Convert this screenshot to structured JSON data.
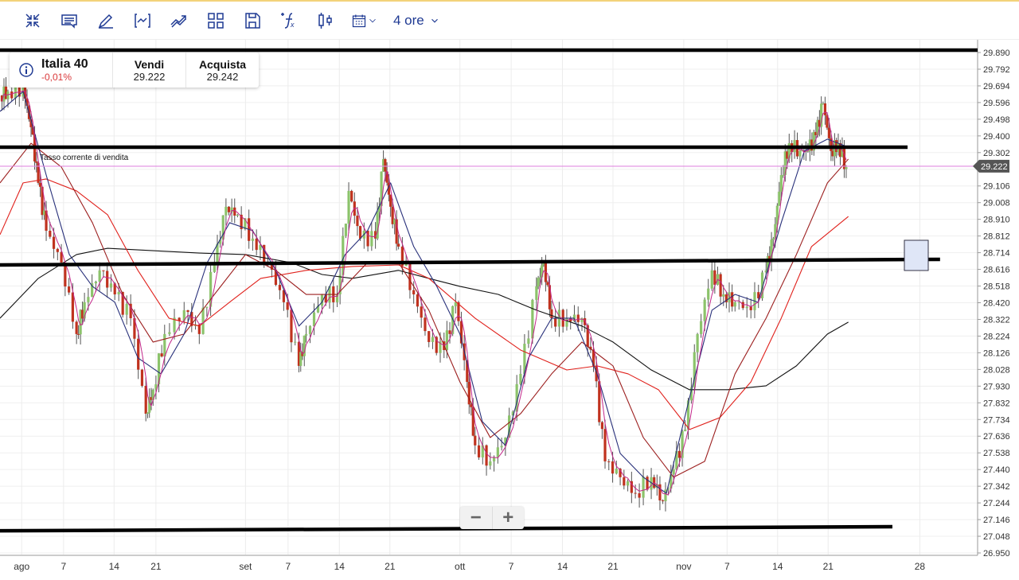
{
  "toolbar": {
    "icons": [
      "collapse-icon",
      "comment-icon",
      "pencil-icon",
      "indicator-bracket-icon",
      "trend-icon",
      "grid-layout-icon",
      "save-icon",
      "function-icon",
      "candlestick-icon",
      "calendar-icon"
    ],
    "timeframe": "4 ore"
  },
  "instrument": {
    "name": "Italia 40",
    "change": "-0,01%",
    "sell_label": "Vendi",
    "sell_value": "29.222",
    "buy_label": "Acquista",
    "buy_value": "29.242"
  },
  "zoom": {
    "minus": "−",
    "plus": "+"
  },
  "colors": {
    "up": "#8cc36b",
    "down": "#c0321e",
    "ma200": "#111111",
    "ma100": "#e0201b",
    "ma50": "#9c1f1f",
    "ma20": "#28307a",
    "ma10": "#c2278a",
    "current": "#e08be0",
    "accent": "#1f3a93"
  },
  "chart_data": {
    "type": "candlestick",
    "current_price_label": "Tasso corrente di vendita",
    "current_price": 29.222,
    "current_price_text": "29.222",
    "ylim": [
      26.95,
      29.89
    ],
    "y_ticks": [
      "29.890",
      "29.792",
      "29.694",
      "29.596",
      "29.498",
      "29.400",
      "29.302",
      "29.106",
      "29.008",
      "28.910",
      "28.812",
      "28.714",
      "28.616",
      "28.518",
      "28.420",
      "28.322",
      "28.224",
      "28.126",
      "28.028",
      "27.930",
      "27.832",
      "27.734",
      "27.636",
      "27.538",
      "27.440",
      "27.342",
      "27.244",
      "27.146",
      "27.048",
      "26.950"
    ],
    "x_ticks": [
      {
        "t": 0,
        "label": "ago"
      },
      {
        "t": 5.8,
        "label": "7"
      },
      {
        "t": 12.8,
        "label": "14"
      },
      {
        "t": 18.6,
        "label": "21"
      },
      {
        "t": 31,
        "label": "set"
      },
      {
        "t": 36.9,
        "label": "7"
      },
      {
        "t": 44,
        "label": "14"
      },
      {
        "t": 51,
        "label": "21"
      },
      {
        "t": 60.7,
        "label": "ott"
      },
      {
        "t": 67.8,
        "label": "7"
      },
      {
        "t": 74.9,
        "label": "14"
      },
      {
        "t": 81.9,
        "label": "21"
      },
      {
        "t": 91.7,
        "label": "nov"
      },
      {
        "t": 97.7,
        "label": "7"
      },
      {
        "t": 104.7,
        "label": "14"
      },
      {
        "t": 111.7,
        "label": "21"
      },
      {
        "t": 124.4,
        "label": "28"
      }
    ],
    "xlim": [
      -3,
      132.4
    ],
    "closes": [
      [
        -3.0,
        29.638
      ],
      [
        -1.9,
        29.661
      ],
      [
        0.2,
        29.684
      ],
      [
        1.3,
        29.451
      ],
      [
        2.3,
        29.124
      ],
      [
        3.4,
        28.843
      ],
      [
        5.5,
        28.656
      ],
      [
        7.6,
        28.236
      ],
      [
        8.7,
        28.423
      ],
      [
        10.8,
        28.61
      ],
      [
        12.9,
        28.469
      ],
      [
        15.1,
        28.329
      ],
      [
        17.2,
        27.768
      ],
      [
        18.2,
        27.909
      ],
      [
        19.8,
        28.236
      ],
      [
        22.5,
        28.376
      ],
      [
        24.6,
        28.236
      ],
      [
        26.7,
        28.656
      ],
      [
        28.3,
        28.984
      ],
      [
        29.9,
        28.937
      ],
      [
        32.0,
        28.797
      ],
      [
        34.1,
        28.656
      ],
      [
        36.3,
        28.423
      ],
      [
        38.4,
        28.049
      ],
      [
        39.4,
        28.236
      ],
      [
        41.6,
        28.469
      ],
      [
        43.7,
        28.469
      ],
      [
        45.3,
        29.077
      ],
      [
        46.9,
        28.797
      ],
      [
        49.0,
        28.797
      ],
      [
        50.1,
        29.264
      ],
      [
        51.1,
        28.984
      ],
      [
        52.2,
        28.75
      ],
      [
        54.3,
        28.469
      ],
      [
        56.4,
        28.189
      ],
      [
        58.5,
        28.142
      ],
      [
        60.1,
        28.423
      ],
      [
        61.7,
        27.955
      ],
      [
        62.8,
        27.582
      ],
      [
        64.9,
        27.488
      ],
      [
        67.0,
        27.628
      ],
      [
        69.1,
        28.002
      ],
      [
        71.3,
        28.516
      ],
      [
        72.3,
        28.656
      ],
      [
        73.4,
        28.329
      ],
      [
        75.5,
        28.329
      ],
      [
        77.6,
        28.329
      ],
      [
        79.2,
        28.049
      ],
      [
        80.8,
        27.488
      ],
      [
        82.9,
        27.395
      ],
      [
        85.0,
        27.301
      ],
      [
        87.2,
        27.395
      ],
      [
        88.8,
        27.254
      ],
      [
        90.3,
        27.441
      ],
      [
        91.9,
        27.675
      ],
      [
        93.6,
        28.236
      ],
      [
        95.6,
        28.61
      ],
      [
        97.2,
        28.469
      ],
      [
        98.8,
        28.423
      ],
      [
        101.0,
        28.376
      ],
      [
        103.1,
        28.61
      ],
      [
        104.1,
        28.797
      ],
      [
        105.2,
        29.17
      ],
      [
        106.3,
        29.357
      ],
      [
        107.8,
        29.311
      ],
      [
        108.9,
        29.311
      ],
      [
        110.0,
        29.404
      ],
      [
        111.0,
        29.591
      ],
      [
        112.1,
        29.311
      ],
      [
        113.1,
        29.357
      ],
      [
        114.2,
        29.217
      ]
    ],
    "moving_averages": [
      {
        "name": "ma200",
        "points": [
          [
            -3.0,
            28.329
          ],
          [
            2.3,
            28.563
          ],
          [
            7.6,
            28.703
          ],
          [
            11.9,
            28.74
          ],
          [
            18.2,
            28.726
          ],
          [
            24.6,
            28.712
          ],
          [
            31.0,
            28.703
          ],
          [
            37.3,
            28.656
          ],
          [
            41.6,
            28.586
          ],
          [
            45.8,
            28.563
          ],
          [
            52.2,
            28.61
          ],
          [
            56.4,
            28.563
          ],
          [
            60.7,
            28.516
          ],
          [
            66.0,
            28.469
          ],
          [
            71.3,
            28.376
          ],
          [
            77.6,
            28.283
          ],
          [
            81.9,
            28.189
          ],
          [
            87.2,
            28.025
          ],
          [
            92.5,
            27.909
          ],
          [
            97.8,
            27.909
          ],
          [
            103.1,
            27.932
          ],
          [
            107.3,
            28.049
          ],
          [
            111.6,
            28.236
          ],
          [
            114.5,
            28.306
          ]
        ]
      },
      {
        "name": "ma100",
        "points": [
          [
            -3.0,
            28.82
          ],
          [
            0.2,
            29.124
          ],
          [
            3.4,
            29.147
          ],
          [
            7.6,
            29.077
          ],
          [
            11.9,
            28.937
          ],
          [
            16.1,
            28.61
          ],
          [
            20.4,
            28.329
          ],
          [
            24.6,
            28.283
          ],
          [
            28.8,
            28.423
          ],
          [
            33.1,
            28.563
          ],
          [
            39.4,
            28.61
          ],
          [
            45.8,
            28.633
          ],
          [
            52.2,
            28.642
          ],
          [
            56.4,
            28.563
          ],
          [
            62.8,
            28.329
          ],
          [
            69.1,
            28.142
          ],
          [
            75.5,
            28.025
          ],
          [
            79.7,
            28.049
          ],
          [
            84.0,
            28.002
          ],
          [
            88.2,
            27.909
          ],
          [
            92.5,
            27.675
          ],
          [
            96.7,
            27.745
          ],
          [
            101.0,
            27.955
          ],
          [
            105.2,
            28.329
          ],
          [
            109.4,
            28.75
          ],
          [
            114.5,
            28.927
          ]
        ]
      },
      {
        "name": "ma50",
        "points": [
          [
            -3.0,
            29.124
          ],
          [
            1.3,
            29.357
          ],
          [
            5.5,
            29.217
          ],
          [
            9.8,
            28.89
          ],
          [
            14.0,
            28.469
          ],
          [
            18.2,
            28.189
          ],
          [
            22.5,
            28.236
          ],
          [
            26.7,
            28.469
          ],
          [
            31.0,
            28.703
          ],
          [
            35.2,
            28.61
          ],
          [
            39.4,
            28.469
          ],
          [
            43.7,
            28.469
          ],
          [
            47.9,
            28.656
          ],
          [
            52.2,
            28.656
          ],
          [
            56.4,
            28.376
          ],
          [
            60.7,
            27.955
          ],
          [
            64.9,
            27.628
          ],
          [
            69.1,
            27.768
          ],
          [
            73.4,
            28.002
          ],
          [
            77.6,
            28.189
          ],
          [
            81.9,
            28.049
          ],
          [
            86.1,
            27.628
          ],
          [
            90.3,
            27.395
          ],
          [
            94.6,
            27.488
          ],
          [
            98.8,
            28.002
          ],
          [
            103.1,
            28.329
          ],
          [
            107.3,
            28.703
          ],
          [
            111.6,
            29.124
          ],
          [
            114.5,
            29.264
          ]
        ]
      },
      {
        "name": "ma20",
        "points": [
          [
            -3.0,
            29.544
          ],
          [
            0.2,
            29.661
          ],
          [
            3.4,
            29.17
          ],
          [
            6.6,
            28.703
          ],
          [
            9.8,
            28.516
          ],
          [
            12.9,
            28.423
          ],
          [
            16.1,
            28.096
          ],
          [
            19.3,
            28.002
          ],
          [
            22.5,
            28.236
          ],
          [
            25.7,
            28.656
          ],
          [
            28.8,
            28.89
          ],
          [
            32.0,
            28.843
          ],
          [
            35.2,
            28.61
          ],
          [
            38.4,
            28.283
          ],
          [
            41.6,
            28.423
          ],
          [
            44.8,
            28.703
          ],
          [
            47.9,
            28.843
          ],
          [
            51.1,
            29.124
          ],
          [
            54.3,
            28.75
          ],
          [
            57.5,
            28.516
          ],
          [
            60.7,
            28.236
          ],
          [
            63.8,
            27.722
          ],
          [
            67.0,
            27.582
          ],
          [
            70.2,
            28.096
          ],
          [
            73.4,
            28.329
          ],
          [
            76.5,
            28.329
          ],
          [
            79.7,
            28.002
          ],
          [
            82.9,
            27.535
          ],
          [
            86.1,
            27.395
          ],
          [
            89.3,
            27.301
          ],
          [
            92.5,
            27.862
          ],
          [
            95.6,
            28.376
          ],
          [
            98.8,
            28.469
          ],
          [
            102.0,
            28.423
          ],
          [
            105.2,
            28.89
          ],
          [
            108.4,
            29.311
          ],
          [
            111.6,
            29.381
          ],
          [
            114.5,
            29.334
          ]
        ]
      }
    ],
    "drawn_lines": [
      {
        "name": "resistance-top",
        "from": [
          -3,
          29.904
        ],
        "to": [
          132.4,
          29.904
        ]
      },
      {
        "name": "resistance-mid",
        "from": [
          -3,
          29.334
        ],
        "to": [
          122.7,
          29.334
        ]
      },
      {
        "name": "support-mid",
        "from": [
          -3,
          28.642
        ],
        "to": [
          127.2,
          28.675
        ]
      },
      {
        "name": "support-bottom",
        "from": [
          -3,
          27.08
        ],
        "to": [
          120.6,
          27.104
        ]
      }
    ]
  }
}
